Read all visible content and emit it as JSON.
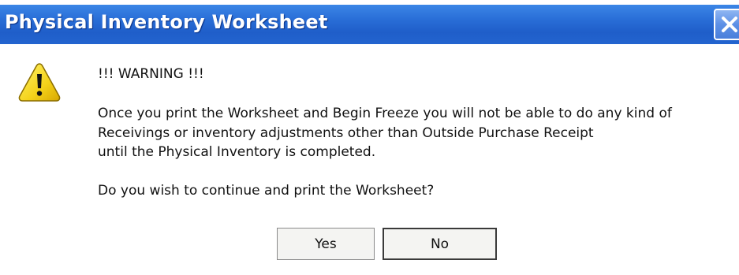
{
  "window": {
    "title": "Physical Inventory Worksheet",
    "close_icon": "close-icon",
    "titlebar_color": "#2a6fd8"
  },
  "dialog": {
    "icon": "warning-icon",
    "warning_heading": "!!! WARNING !!!",
    "message_lines": [
      "Once you print the Worksheet and Begin Freeze you will not be able to do any kind of",
      "Receivings or inventory adjustments other than Outside Purchase Receipt",
      "until the Physical Inventory is completed."
    ],
    "question": "Do you wish to continue and print the Worksheet?"
  },
  "buttons": {
    "yes_label": "Yes",
    "no_label": "No"
  }
}
